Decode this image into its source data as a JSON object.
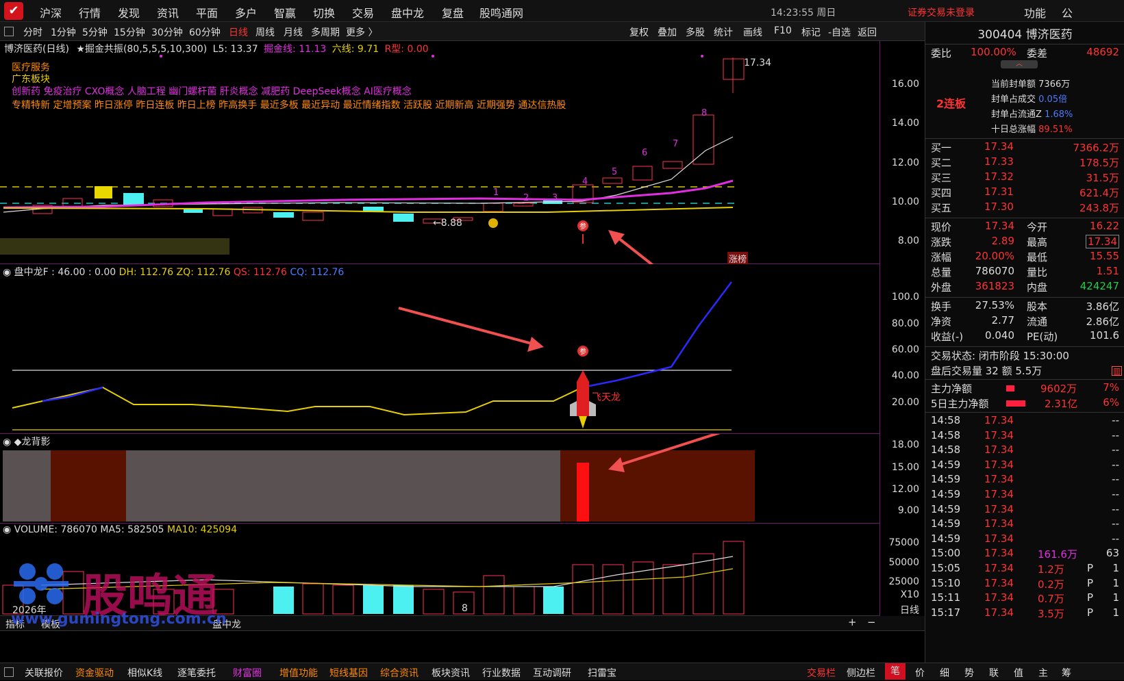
{
  "topbar": {
    "logo": "✔",
    "menus": [
      "沪深",
      "行情",
      "发现",
      "资讯",
      "平面",
      "多户",
      "智赢",
      "切换",
      "交易",
      "盘中龙",
      "复盘",
      "股鸣通网"
    ],
    "time": "14:23:55 周日",
    "login": "证券交易未登录",
    "func": "功能",
    "pub": "公"
  },
  "periodbar": {
    "items": [
      "分时",
      "1分钟",
      "5分钟",
      "15分钟",
      "30分钟",
      "60分钟",
      "日线",
      "周线",
      "月线",
      "多周期",
      "更多 〉"
    ],
    "right_items": [
      "复权",
      "叠加",
      "多股",
      "统计",
      "画线",
      "F10",
      "标记",
      "-自选",
      "返回"
    ]
  },
  "main": {
    "header_name": "博济医药(日线)",
    "header_indicator": "★掘金共振(80,5,5,5,10,300)",
    "l5": "L5: 13.37",
    "jjx": "掘金线: 11.13",
    "lx": "六线: 9.71",
    "rx": "R型: 0.00",
    "tag1": "医疗服务",
    "tag2": "广东板块",
    "concepts": "创新药 免疫治疗 CXO概念 人脑工程 幽门螺杆菌 肝炎概念 减肥药 DeepSeek概念 AI医疗概念",
    "features": "专精特新 定增预案 昨日涨停 昨日连板 昨日上榜 昨高换手 最近多板 最近异动 最近情绪指数 活跃股 近期新高 近期强势 通达信热股",
    "high_label": "17.34",
    "low_label": "←8.88",
    "board_label": "涨榜",
    "ticks": [
      "16.00",
      "14.00",
      "12.00",
      "10.00",
      "8.00"
    ],
    "numbers": [
      "1",
      "2",
      "3",
      "4",
      "5",
      "6",
      "7",
      "8"
    ]
  },
  "panel2": {
    "title": "盘中龙F : 46.00 : 0.00",
    "dh": "DH: 112.76",
    "zq": "ZQ: 112.76",
    "qs": "QS: 112.76",
    "cq": "CQ: 112.76",
    "rocket": "飞天龙",
    "ticks": [
      "100.0",
      "80.00",
      "60.00",
      "40.00",
      "20.00"
    ]
  },
  "panel3": {
    "title": "◆龙背影",
    "ticks": [
      "18.00",
      "15.00",
      "12.00",
      "9.00"
    ]
  },
  "panel4": {
    "vol": "VOLUME: 786070",
    "ma5": "MA5: 582505",
    "ma10": "MA10: 425094",
    "ticks": [
      "75000",
      "50000",
      "25000"
    ],
    "unit": "X10",
    "year": "2026年",
    "xtick": "8",
    "period": "日线",
    "watermark": "股鸣通",
    "url": "www.gumingtong.com.cn"
  },
  "right": {
    "code": "300404 博济医药",
    "wb_label": "委比",
    "wb": "100.00%",
    "wc_label": "委差",
    "wc": "48692",
    "lianban": "2连板",
    "seal_lines": [
      {
        "label": "当前封单额",
        "value": "7366万"
      },
      {
        "label": "封单占成交",
        "value": "0.05倍"
      },
      {
        "label": "封单占流通Z",
        "value": "1.68%"
      },
      {
        "label": "十日总涨幅",
        "value": "89.51%"
      }
    ],
    "buys": [
      {
        "label": "买一",
        "price": "17.34",
        "vol": "7366.2万"
      },
      {
        "label": "买二",
        "price": "17.33",
        "vol": "178.5万"
      },
      {
        "label": "买三",
        "price": "17.32",
        "vol": "31.5万"
      },
      {
        "label": "买四",
        "price": "17.31",
        "vol": "621.4万"
      },
      {
        "label": "买五",
        "price": "17.30",
        "vol": "243.8万"
      }
    ],
    "quote": [
      {
        "l1": "现价",
        "v1": "17.34",
        "l2": "今开",
        "v2": "16.22"
      },
      {
        "l1": "涨跌",
        "v1": "2.89",
        "l2": "最高",
        "v2": "17.34"
      },
      {
        "l1": "涨幅",
        "v1": "20.00%",
        "l2": "最低",
        "v2": "15.55"
      },
      {
        "l1": "总量",
        "v1": "786070",
        "l2": "量比",
        "v2": "1.51"
      },
      {
        "l1": "外盘",
        "v1": "361823",
        "l2": "内盘",
        "v2": "424247"
      }
    ],
    "stats": [
      {
        "l1": "换手",
        "v1": "27.53%",
        "l2": "股本",
        "v2": "3.86亿"
      },
      {
        "l1": "净资",
        "v1": "2.77",
        "l2": "流通",
        "v2": "2.86亿"
      },
      {
        "l1": "收益(-)",
        "v1": "0.040",
        "l2": "PE(动)",
        "v2": "101.6"
      }
    ],
    "status1": "交易状态: 闭市阶段 15:30:00",
    "status2": "盘后交易量 32 额 5.5万",
    "flow1": {
      "label": "主力净额",
      "value": "9602万",
      "pct": "7%"
    },
    "flow2": {
      "label": "5日主力净额",
      "value": "2.31亿",
      "pct": "6%"
    },
    "ticks_list": [
      {
        "t": "14:58",
        "p": "17.34",
        "v": "",
        "f": "",
        "n": "--"
      },
      {
        "t": "14:58",
        "p": "17.34",
        "v": "",
        "f": "",
        "n": "--"
      },
      {
        "t": "14:58",
        "p": "17.34",
        "v": "",
        "f": "",
        "n": "--"
      },
      {
        "t": "14:59",
        "p": "17.34",
        "v": "",
        "f": "",
        "n": "--"
      },
      {
        "t": "14:59",
        "p": "17.34",
        "v": "",
        "f": "",
        "n": "--"
      },
      {
        "t": "14:59",
        "p": "17.34",
        "v": "",
        "f": "",
        "n": "--"
      },
      {
        "t": "14:59",
        "p": "17.34",
        "v": "",
        "f": "",
        "n": "--"
      },
      {
        "t": "14:59",
        "p": "17.34",
        "v": "",
        "f": "",
        "n": "--"
      },
      {
        "t": "14:59",
        "p": "17.34",
        "v": "",
        "f": "",
        "n": "--"
      },
      {
        "t": "15:00",
        "p": "17.34",
        "v": "161.6万",
        "f": "",
        "n": "63"
      },
      {
        "t": "15:05",
        "p": "17.34",
        "v": "1.2万",
        "f": "P",
        "n": "1"
      },
      {
        "t": "15:10",
        "p": "17.34",
        "v": "0.2万",
        "f": "P",
        "n": "1"
      },
      {
        "t": "15:11",
        "p": "17.34",
        "v": "0.7万",
        "f": "P",
        "n": "1"
      },
      {
        "t": "15:17",
        "p": "17.34",
        "v": "3.5万",
        "f": "P",
        "n": "1"
      }
    ],
    "tabs": [
      "笔",
      "价",
      "细",
      "势",
      "联",
      "值",
      "主",
      "筹"
    ]
  },
  "bottombar": {
    "items": [
      "关联报价",
      "资金驱动",
      "相似K线",
      "逐笔委托",
      "财富圈",
      "增值功能",
      "短线基因",
      "综合资讯",
      "板块资讯",
      "行业数据",
      "互动调研",
      "扫雷宝"
    ],
    "right": [
      "交易栏",
      "侧边栏"
    ],
    "zoom": [
      "+",
      "−"
    ],
    "subtabs": [
      "指标",
      "模板",
      "模",
      "个",
      "指",
      "预",
      "板",
      "盘中龙"
    ]
  }
}
